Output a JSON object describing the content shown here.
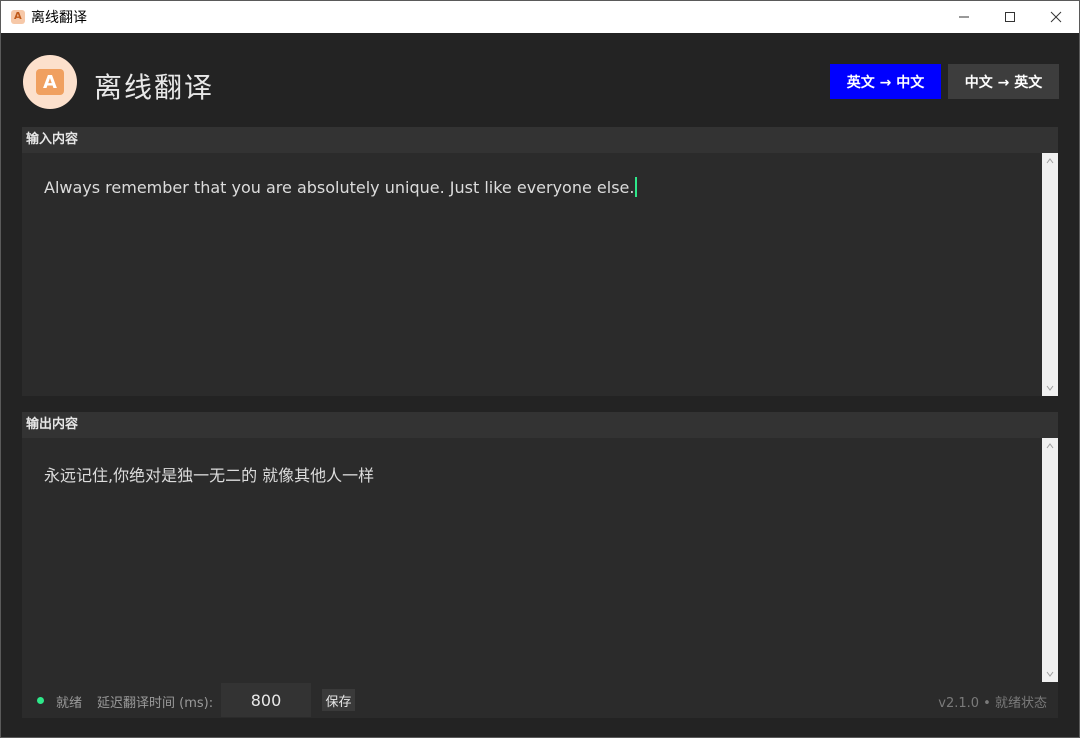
{
  "window": {
    "title": "离线翻译"
  },
  "header": {
    "app_title": "离线翻译",
    "logo_letter": "A",
    "modes": [
      {
        "label": "英文 → 中文",
        "active": true
      },
      {
        "label": "中文 → 英文",
        "active": false
      }
    ]
  },
  "input": {
    "header": "输入内容",
    "text": "Always remember that you are absolutely unique. Just like everyone else."
  },
  "output": {
    "header": "输出内容",
    "text": "永远记住,你绝对是独一无二的 就像其他人一样"
  },
  "status": {
    "state": "就绪",
    "delay_label": "延迟翻译时间 (ms):",
    "delay_value": "800",
    "save_label": "保存",
    "version": "v2.1.0 • 就绪状态"
  },
  "colors": {
    "accent": "#0000ff",
    "status_ok": "#2ee88a",
    "background": "#232323"
  }
}
